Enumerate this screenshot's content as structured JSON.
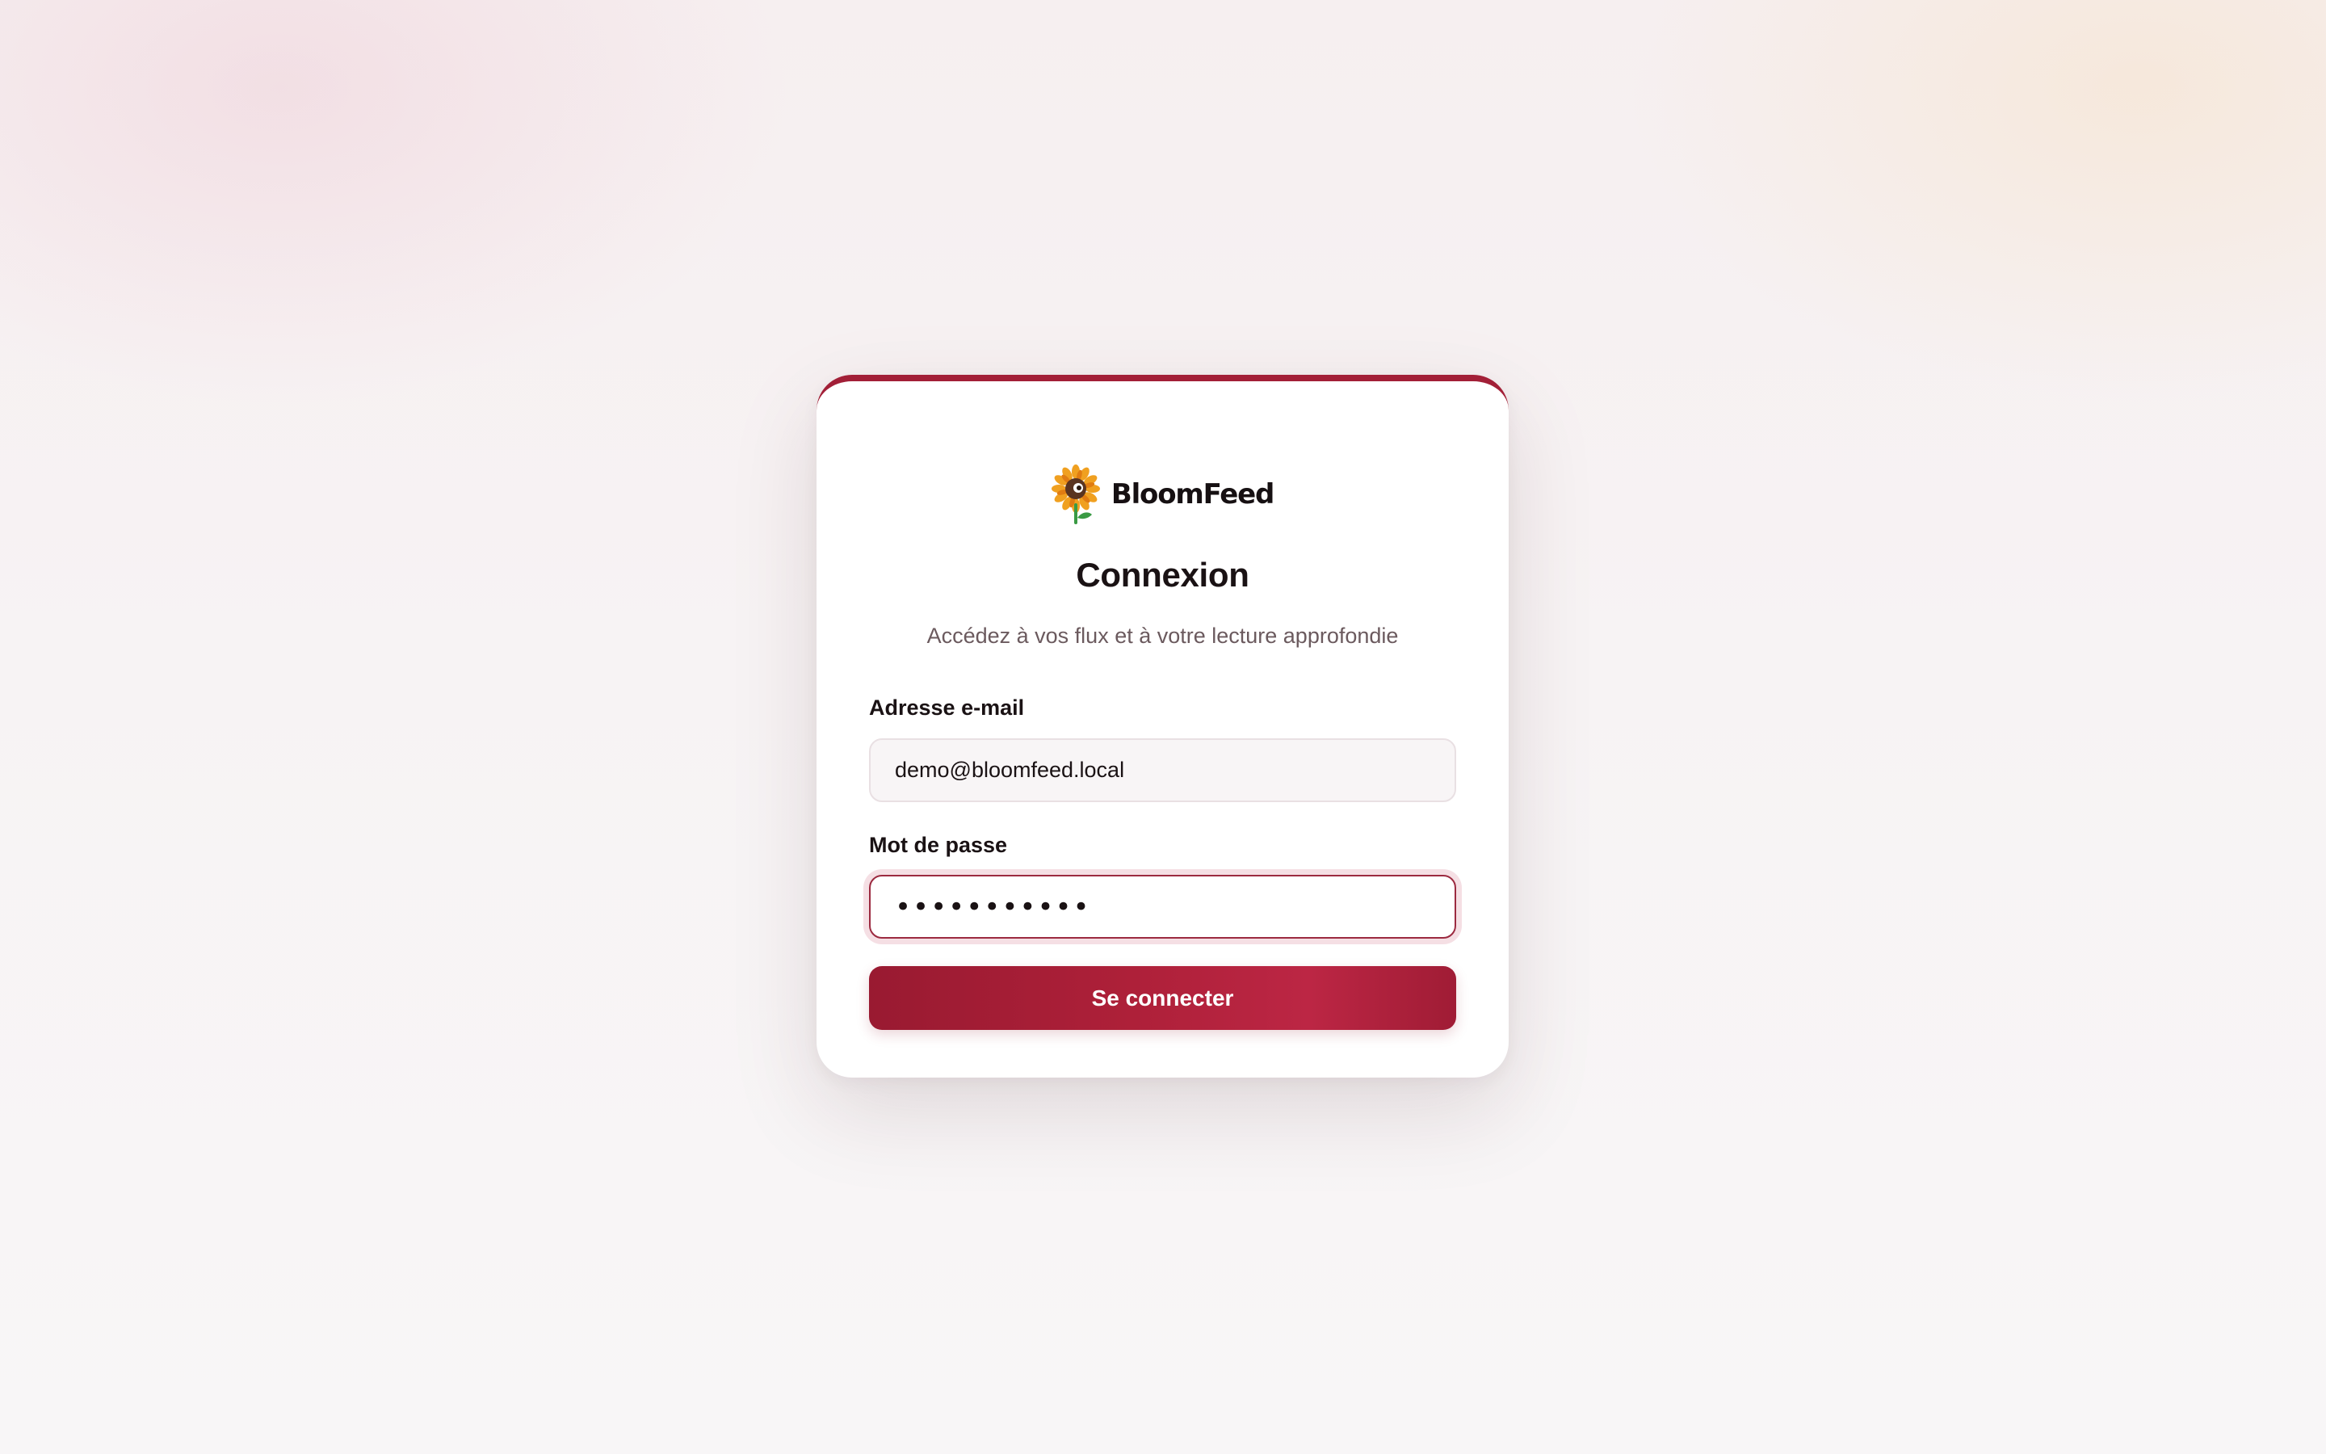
{
  "brand": {
    "name": "BloomFeed",
    "logo_icon": "sunflower-icon"
  },
  "login": {
    "title": "Connexion",
    "subtitle": "Accédez à vos flux et à votre lecture approfondie",
    "email_label": "Adresse e-mail",
    "email_value": "demo@bloomfeed.local",
    "password_label": "Mot de passe",
    "password_value": "•••••••••••",
    "submit_label": "Se connecter",
    "password_field_focused": true
  },
  "colors": {
    "accent": "#a21f37",
    "button_gradient_start": "#991a31",
    "button_gradient_end": "#bc2644",
    "title_text": "#1a1214",
    "subtitle_text": "#6b5a5e"
  }
}
